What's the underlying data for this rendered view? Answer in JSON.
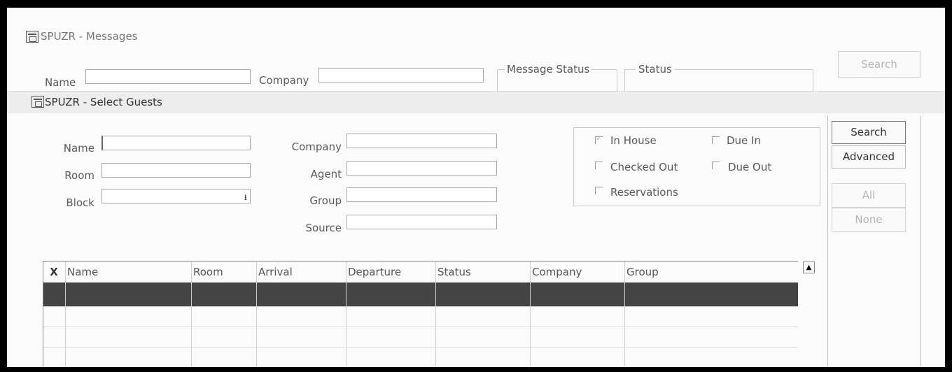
{
  "bg_window": {
    "title": "SPUZR - Messages",
    "name_label": "Name",
    "company_label": "Company",
    "message_status_label": "Message Status",
    "status_label": "Status",
    "search_label": "Search"
  },
  "dialog": {
    "title": "SPUZR - Select Guests",
    "fields": {
      "name": "Name",
      "room": "Room",
      "block": "Block",
      "company": "Company",
      "agent": "Agent",
      "group": "Group",
      "source": "Source"
    },
    "checkboxes": {
      "in_house": "In House",
      "due_in": "Due In",
      "checked_out": "Checked Out",
      "due_out": "Due Out",
      "reservations": "Reservations"
    },
    "buttons": {
      "search": "Search",
      "advanced": "Advanced",
      "all": "All",
      "none": "None"
    },
    "grid": {
      "columns": [
        "X",
        "Name",
        "Room",
        "Arrival",
        "Departure",
        "Status",
        "Company",
        "Group"
      ]
    }
  }
}
